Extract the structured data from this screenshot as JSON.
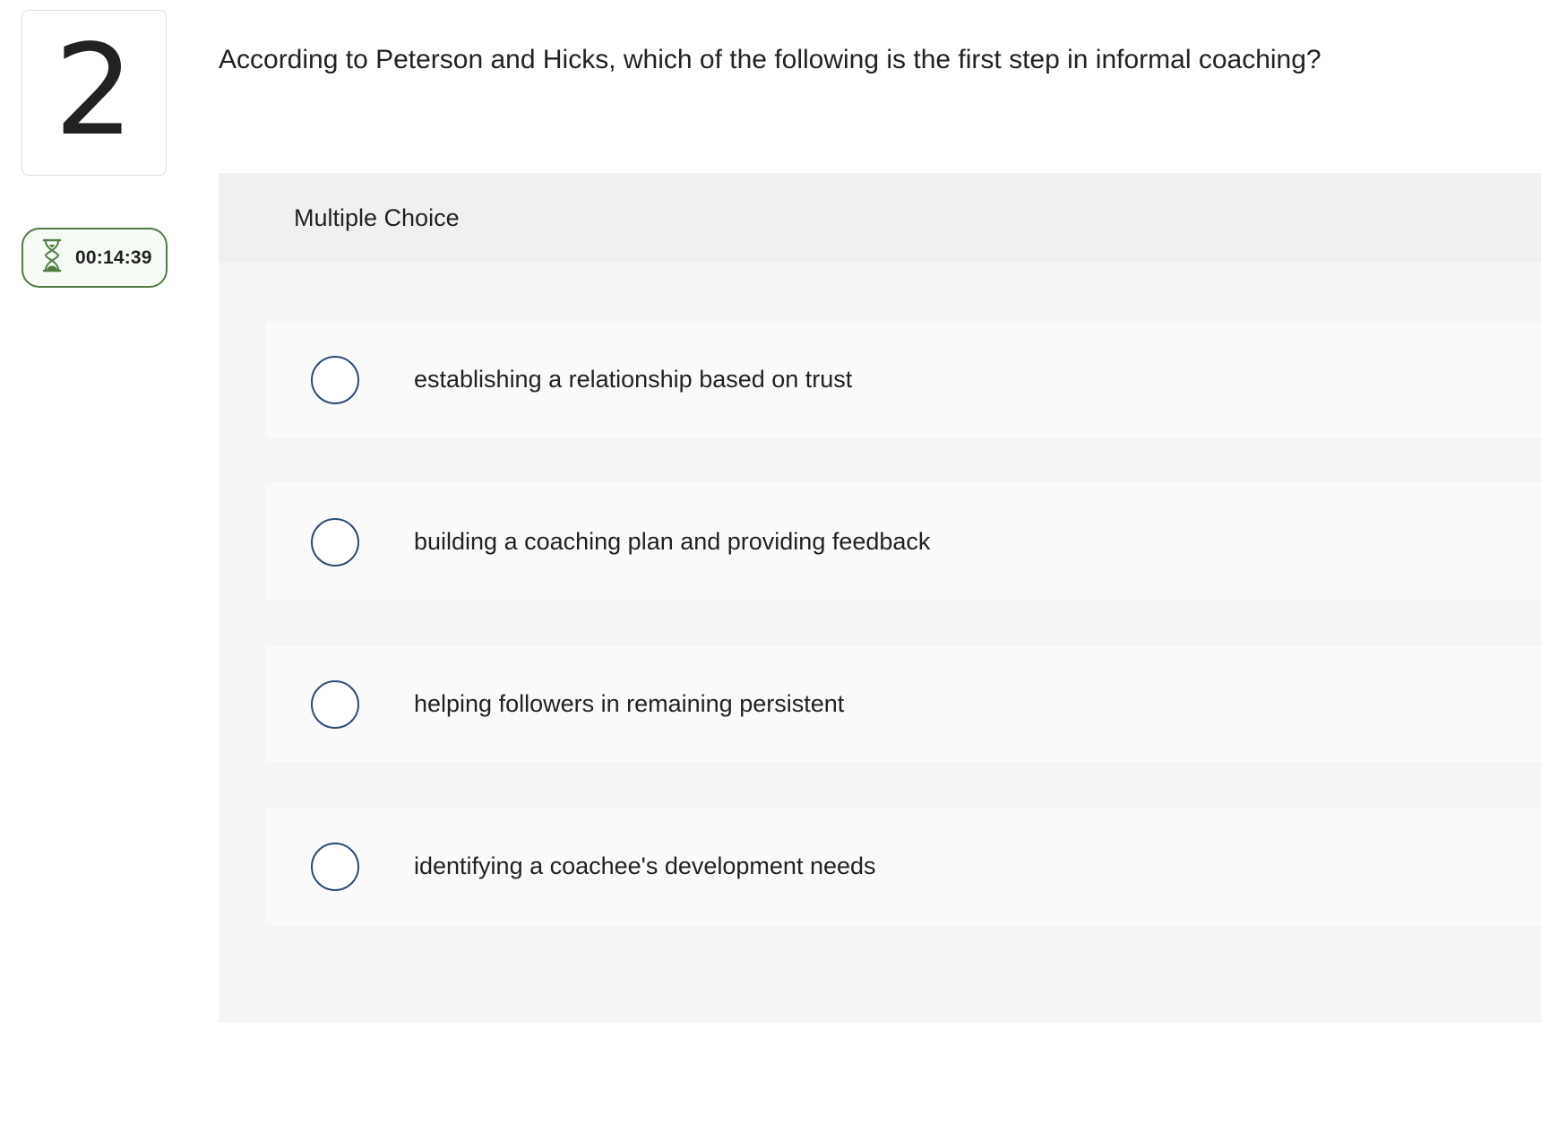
{
  "question": {
    "number": "2",
    "text": "According to Peterson and Hicks, which of the following is the first step in informal coaching?"
  },
  "timer": {
    "icon": "hourglass-icon",
    "time": "00:14:39",
    "accent_color": "#4f7d43"
  },
  "answer_panel": {
    "type_label": "Multiple Choice",
    "options": [
      {
        "label": "establishing a relationship based on trust",
        "selected": false
      },
      {
        "label": "building a coaching plan and providing feedback",
        "selected": false
      },
      {
        "label": "helping followers in remaining persistent",
        "selected": false
      },
      {
        "label": "identifying a coachee's development needs",
        "selected": false
      }
    ],
    "radio_color": "#2b4a75"
  }
}
